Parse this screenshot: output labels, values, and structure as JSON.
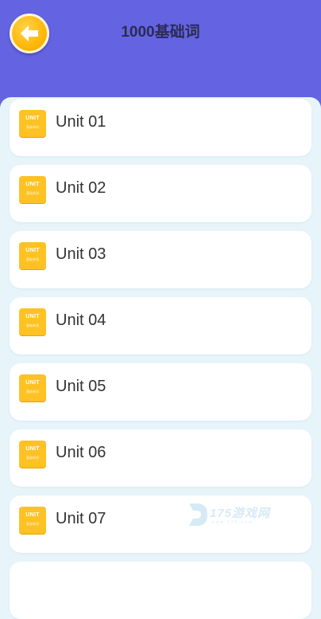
{
  "header": {
    "title": "1000基础词",
    "back_icon": "arrow-left-icon",
    "background_color": "#6464e2",
    "back_button_color": "#ffb300"
  },
  "units": {
    "icon_text": "UNIT",
    "icon_subtext": "基础单词",
    "icon_color": "#ffc224",
    "items": [
      {
        "label": "Unit 01"
      },
      {
        "label": "Unit 02"
      },
      {
        "label": "Unit 03"
      },
      {
        "label": "Unit 04"
      },
      {
        "label": "Unit 05"
      },
      {
        "label": "Unit 06"
      },
      {
        "label": "Unit 07"
      }
    ]
  },
  "watermark": {
    "text": "175游戏网",
    "subtext": "www.175.com"
  }
}
